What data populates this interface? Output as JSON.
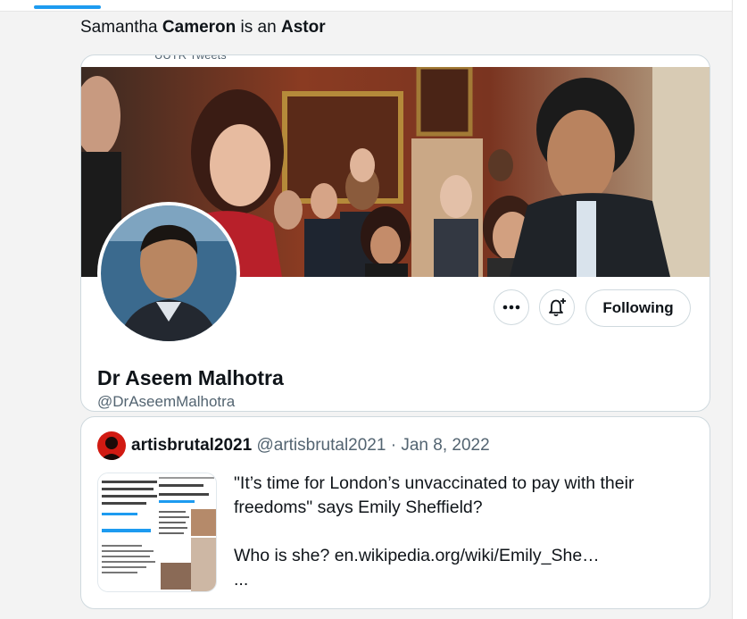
{
  "tweet": {
    "text_before": "Samantha ",
    "bold1": "Cameron",
    "text_mid": " is an ",
    "bold2": "Astor"
  },
  "profile_card": {
    "banner_caption": "UUTR Tweets",
    "name": "Dr Aseem Malhotra",
    "handle": "@DrAseemMalhotra",
    "follow_label": "Following",
    "more_icon": "more-dots-icon",
    "notify_icon": "bell-plus-icon"
  },
  "quote": {
    "author_name": "artisbrutal2021",
    "author_handle": "@artisbrutal2021",
    "separator": " · ",
    "date": "Jan 8, 2022",
    "line1": "\"It’s time for London’s unvaccinated to pay with their",
    "line2": "freedoms\" says Emily Sheffield?",
    "line3": "Who is she? en.wikipedia.org/wiki/Emily_She…",
    "line4": "..."
  },
  "colors": {
    "accent": "#1d9bf0",
    "border": "#cfd9de",
    "muted_text": "#536471"
  }
}
